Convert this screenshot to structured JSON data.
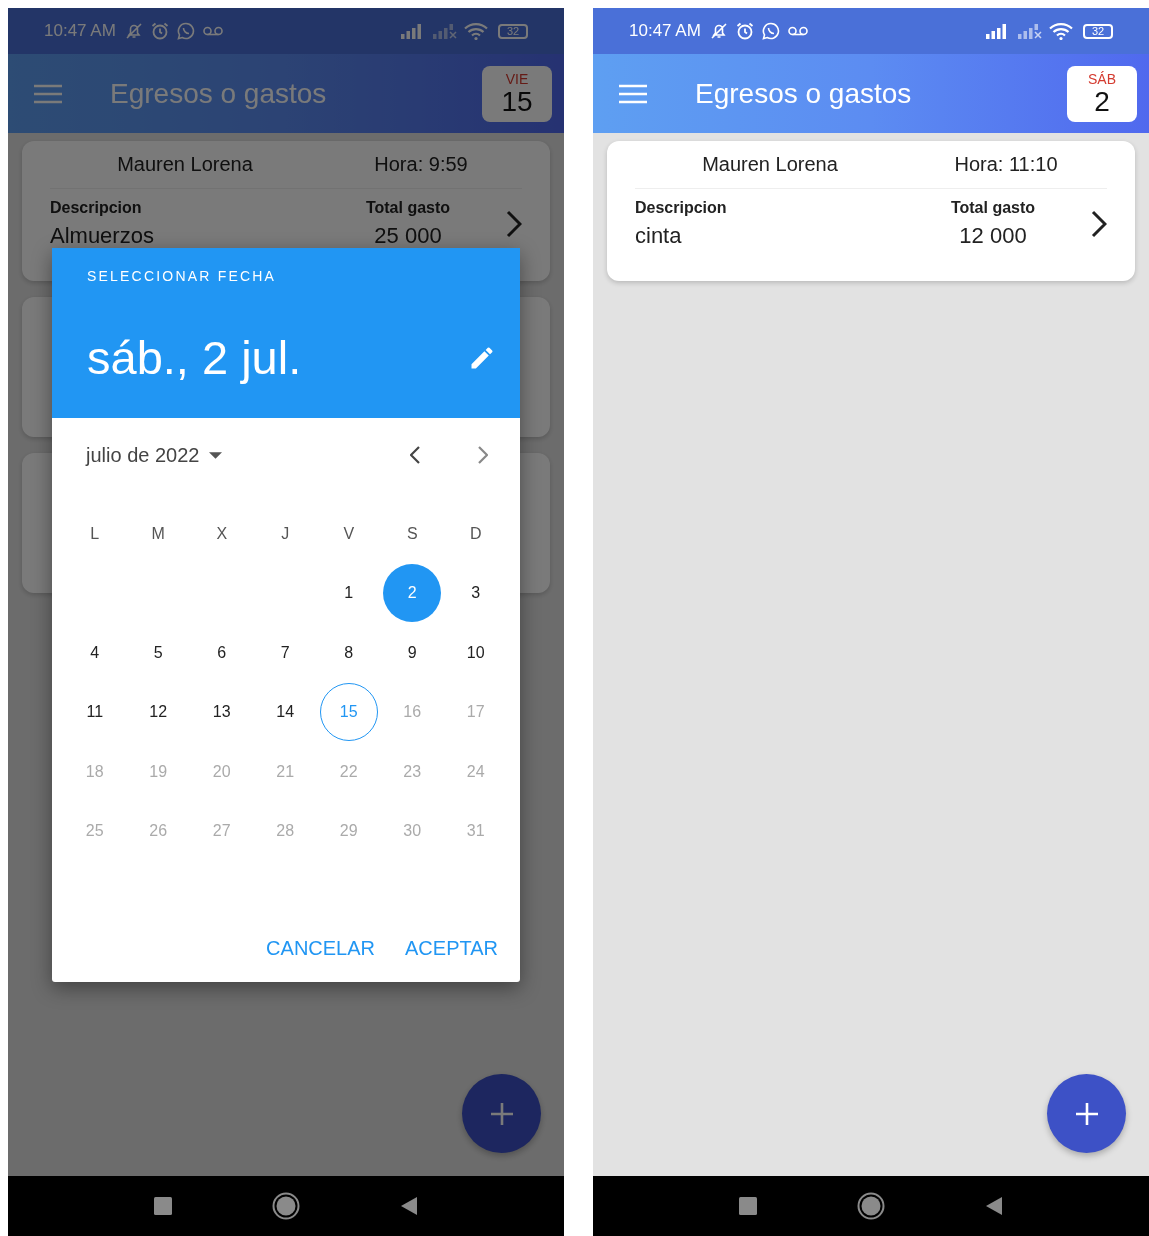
{
  "screens": [
    {
      "status_bar": {
        "time": "10:47 AM",
        "battery": "32"
      },
      "app_bar": {
        "title": "Egresos o gastos",
        "date_badge": {
          "weekday": "VIE",
          "day": "15"
        }
      },
      "cards": [
        {
          "obscured": false,
          "name": "Mauren Lorena",
          "time": "Hora: 9:59",
          "description_label": "Descripcion",
          "description": "Almuerzos",
          "total_label": "Total gasto",
          "total": "25 000"
        },
        {
          "obscured": true
        },
        {
          "obscured": true
        }
      ],
      "dialog": {
        "overline": "SELECCIONAR FECHA",
        "selected_date": "sáb., 2 jul.",
        "month": "julio de 2022",
        "weekdays": [
          "L",
          "M",
          "X",
          "J",
          "V",
          "S",
          "D"
        ],
        "weeks": [
          [
            {
              "label": "1",
              "selected": false,
              "today": false,
              "disabled": false
            },
            {
              "label": "2",
              "selected": true,
              "today": false,
              "disabled": false
            },
            {
              "label": "3",
              "selected": false,
              "today": false,
              "disabled": false
            }
          ],
          [
            {
              "label": "4",
              "selected": false,
              "today": false,
              "disabled": false
            },
            {
              "label": "5",
              "selected": false,
              "today": false,
              "disabled": false
            },
            {
              "label": "6",
              "selected": false,
              "today": false,
              "disabled": false
            },
            {
              "label": "7",
              "selected": false,
              "today": false,
              "disabled": false
            },
            {
              "label": "8",
              "selected": false,
              "today": false,
              "disabled": false
            },
            {
              "label": "9",
              "selected": false,
              "today": false,
              "disabled": false
            },
            {
              "label": "10",
              "selected": false,
              "today": false,
              "disabled": false
            }
          ],
          [
            {
              "label": "11",
              "selected": false,
              "today": false,
              "disabled": false
            },
            {
              "label": "12",
              "selected": false,
              "today": false,
              "disabled": false
            },
            {
              "label": "13",
              "selected": false,
              "today": false,
              "disabled": false
            },
            {
              "label": "14",
              "selected": false,
              "today": false,
              "disabled": false
            },
            {
              "label": "15",
              "selected": false,
              "today": true,
              "disabled": false
            },
            {
              "label": "16",
              "selected": false,
              "today": false,
              "disabled": true
            },
            {
              "label": "17",
              "selected": false,
              "today": false,
              "disabled": true
            }
          ],
          [
            {
              "label": "18",
              "selected": false,
              "today": false,
              "disabled": true
            },
            {
              "label": "19",
              "selected": false,
              "today": false,
              "disabled": true
            },
            {
              "label": "20",
              "selected": false,
              "today": false,
              "disabled": true
            },
            {
              "label": "21",
              "selected": false,
              "today": false,
              "disabled": true
            },
            {
              "label": "22",
              "selected": false,
              "today": false,
              "disabled": true
            },
            {
              "label": "23",
              "selected": false,
              "today": false,
              "disabled": true
            },
            {
              "label": "24",
              "selected": false,
              "today": false,
              "disabled": true
            }
          ],
          [
            {
              "label": "25",
              "selected": false,
              "today": false,
              "disabled": true
            },
            {
              "label": "26",
              "selected": false,
              "today": false,
              "disabled": true
            },
            {
              "label": "27",
              "selected": false,
              "today": false,
              "disabled": true
            },
            {
              "label": "28",
              "selected": false,
              "today": false,
              "disabled": true
            },
            {
              "label": "29",
              "selected": false,
              "today": false,
              "disabled": true
            },
            {
              "label": "30",
              "selected": false,
              "today": false,
              "disabled": true
            },
            {
              "label": "31",
              "selected": false,
              "today": false,
              "disabled": true
            }
          ]
        ],
        "buttons": [
          "CANCELAR",
          "ACEPTAR"
        ]
      }
    },
    {
      "status_bar": {
        "time": "10:47 AM",
        "battery": "32"
      },
      "app_bar": {
        "title": "Egresos o gastos",
        "date_badge": {
          "weekday": "SÁB",
          "day": "2"
        }
      },
      "cards": [
        {
          "obscured": false,
          "name": "Mauren Lorena",
          "time": "Hora: 11:10",
          "description_label": "Descripcion",
          "description": "cinta",
          "total_label": "Total gasto",
          "total": "12 000"
        }
      ]
    }
  ]
}
